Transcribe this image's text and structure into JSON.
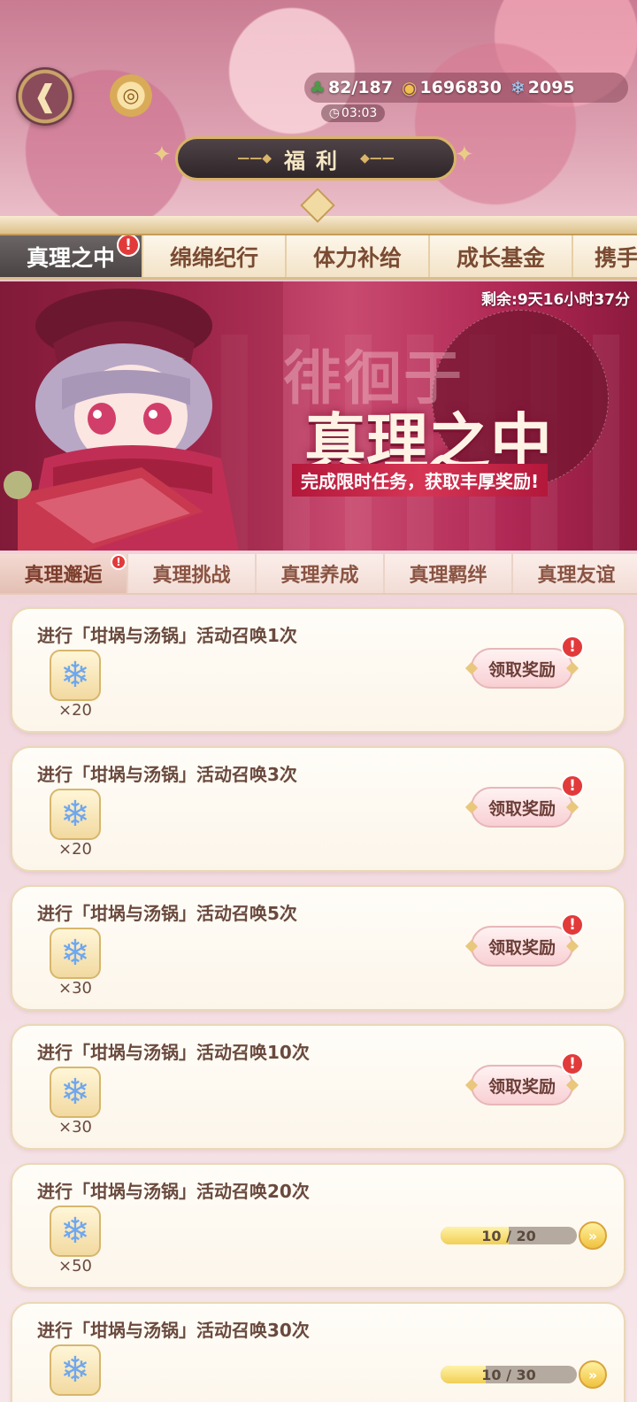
{
  "header": {
    "back_icon": "back-arrow-icon",
    "coin_icon": "coin-shop-icon",
    "stamina": "82/187",
    "gold": "1696830",
    "gems": "2095",
    "timer": "03:03",
    "title": "福利"
  },
  "main_tabs": [
    {
      "label": "真理之中",
      "active": true,
      "badge": "!"
    },
    {
      "label": "绵绵纪行"
    },
    {
      "label": "体力补给"
    },
    {
      "label": "成长基金"
    },
    {
      "label": "携手"
    }
  ],
  "banner": {
    "countdown": "剩余:9天16小时37分",
    "ghost_title": "徘徊于",
    "title": "真理之中",
    "subtitle": "完成限时任务，获取丰厚奖励!"
  },
  "sub_tabs": [
    {
      "label": "真理邂逅",
      "active": true,
      "badge": "!"
    },
    {
      "label": "真理挑战"
    },
    {
      "label": "真理养成"
    },
    {
      "label": "真理羁绊"
    },
    {
      "label": "真理友谊"
    }
  ],
  "tasks": [
    {
      "title": "进行「坩埚与汤锅」活动召唤1次",
      "reward_icon": "crystal-gem-icon",
      "count": "×20",
      "state": "claim",
      "button": "领取奖励",
      "badge": "!"
    },
    {
      "title": "进行「坩埚与汤锅」活动召唤3次",
      "reward_icon": "crystal-gem-icon",
      "count": "×20",
      "state": "claim",
      "button": "领取奖励",
      "badge": "!"
    },
    {
      "title": "进行「坩埚与汤锅」活动召唤5次",
      "reward_icon": "crystal-gem-icon",
      "count": "×30",
      "state": "claim",
      "button": "领取奖励",
      "badge": "!"
    },
    {
      "title": "进行「坩埚与汤锅」活动召唤10次",
      "reward_icon": "crystal-gem-icon",
      "count": "×30",
      "state": "claim",
      "button": "领取奖励",
      "badge": "!"
    },
    {
      "title": "进行「坩埚与汤锅」活动召唤20次",
      "reward_icon": "crystal-gem-icon",
      "count": "×50",
      "state": "progress",
      "progress_text": "10 / 20",
      "progress": 0.5
    },
    {
      "title": "进行「坩埚与汤锅」活动召唤30次",
      "reward_icon": "crystal-gem-icon",
      "count": "",
      "state": "progress",
      "progress_text": "10 / 30",
      "progress": 0.333
    }
  ],
  "colors": {
    "accent_red": "#e23a3a",
    "gold": "#d9b46a",
    "banner_red": "#a52851"
  }
}
